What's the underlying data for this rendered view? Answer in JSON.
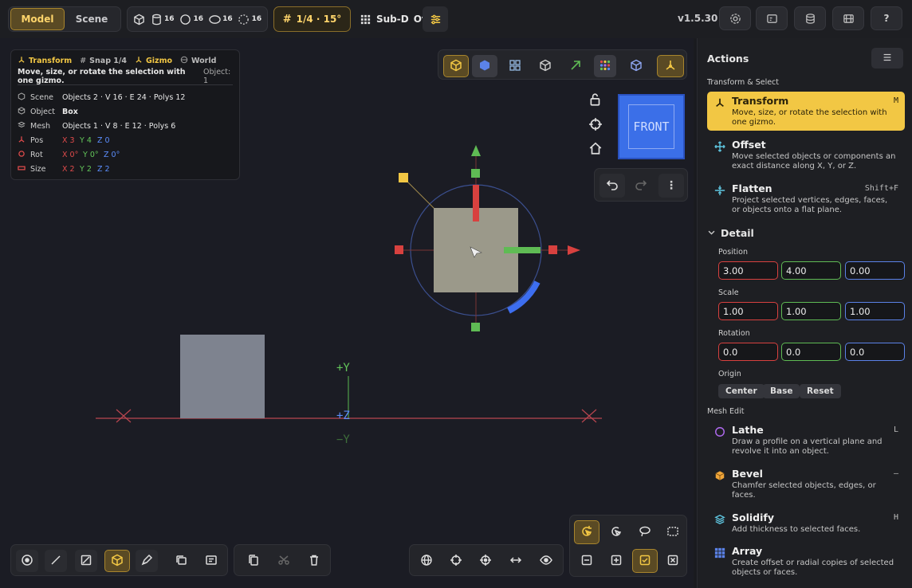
{
  "topbar": {
    "modes": [
      "Model",
      "Scene"
    ],
    "active_mode": "Model",
    "primitives": [
      {
        "icon": "cube-icon",
        "count": ""
      },
      {
        "icon": "cylinder-icon",
        "count": "16"
      },
      {
        "icon": "sphere-icon",
        "count": "16"
      },
      {
        "icon": "torus-icon",
        "count": "16"
      },
      {
        "icon": "circle-dashed-icon",
        "count": "16"
      }
    ],
    "snap": "1/4 · 15°",
    "subd": "Sub-D",
    "subd_state": "Off",
    "version": "v1.5.30"
  },
  "info": {
    "badges": [
      "Transform",
      "Snap 1/4",
      "Gizmo",
      "World"
    ],
    "hint": "Move, size, or rotate the selection with one gizmo.",
    "hint_object": "Object: 1",
    "rows": [
      {
        "label": "Scene",
        "value": "Objects 2 · V 16 · E 24 · Polys 12"
      },
      {
        "label": "Object",
        "value": "Box"
      },
      {
        "label": "Mesh",
        "value": "Objects 1 · V 8 · E 12 · Polys 6"
      }
    ],
    "pos": {
      "label": "Pos",
      "x": "X 3",
      "y": "Y 4",
      "z": "Z 0"
    },
    "rot": {
      "label": "Rot",
      "x": "X 0°",
      "y": "Y 0°",
      "z": "Z 0°"
    },
    "size": {
      "label": "Size",
      "x": "X 2",
      "y": "Y 2",
      "z": "Z 2"
    }
  },
  "viewcube": {
    "label": "FRONT"
  },
  "axes": {
    "y_plus": "+Y",
    "z": "+Z",
    "y_minus": "−Y"
  },
  "actions": {
    "title": "Actions",
    "section_transform": "Transform & Select",
    "items": [
      {
        "name": "Transform",
        "desc": "Move, size, or rotate the selection with one gizmo.",
        "key": "M"
      },
      {
        "name": "Offset",
        "desc": "Move selected objects or components an exact distance along X, Y, or Z.",
        "key": ""
      },
      {
        "name": "Flatten",
        "desc": "Project selected vertices, edges, faces, or objects onto a flat plane.",
        "key": "Shift+F"
      }
    ],
    "detail": "Detail",
    "position_label": "Position",
    "position": [
      "3.00",
      "4.00",
      "0.00"
    ],
    "scale_label": "Scale",
    "scale": [
      "1.00",
      "1.00",
      "1.00"
    ],
    "rotation_label": "Rotation",
    "rotation": [
      "0.0",
      "0.0",
      "0.0"
    ],
    "origin_label": "Origin",
    "origin": [
      "Center",
      "Base",
      "Reset"
    ],
    "section_mesh": "Mesh Edit",
    "mesh_items": [
      {
        "name": "Lathe",
        "desc": "Draw a profile on a vertical plane and revolve it into an object.",
        "key": "L"
      },
      {
        "name": "Bevel",
        "desc": "Chamfer selected objects, edges, or faces.",
        "key": "–"
      },
      {
        "name": "Solidify",
        "desc": "Add thickness to selected faces.",
        "key": "H"
      },
      {
        "name": "Array",
        "desc": "Create offset or radial copies of selected objects or faces.",
        "key": ""
      }
    ]
  },
  "colors": {
    "accent": "#f2c744",
    "x": "#e14b4b",
    "y": "#63c75a",
    "z": "#5b8dfb"
  }
}
